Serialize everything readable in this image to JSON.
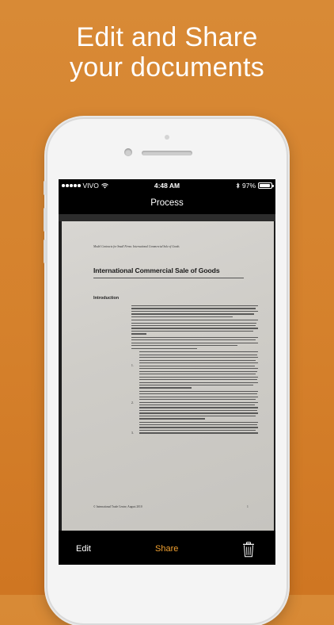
{
  "headline": {
    "line1": "Edit and Share",
    "line2": "your documents"
  },
  "status_bar": {
    "carrier": "VIVO",
    "time": "4:48 AM",
    "battery": "97%"
  },
  "nav": {
    "title": "Process"
  },
  "document": {
    "running_head": "Model Contracts for Small Firms: International Commercial Sale of Goods",
    "title": "International Commercial Sale of Goods",
    "section": "Introduction",
    "item_numbers": [
      "1.",
      "2.",
      "3."
    ],
    "footer": "© International Trade Centre, August 2010",
    "page_number": "1"
  },
  "toolbar": {
    "edit_label": "Edit",
    "share_label": "Share"
  },
  "colors": {
    "background": "#d5812c",
    "accent": "#f0a030"
  },
  "icons": {
    "trash": "trash-icon",
    "wifi": "wifi-icon",
    "bluetooth": "bluetooth-icon",
    "battery": "battery-icon"
  }
}
